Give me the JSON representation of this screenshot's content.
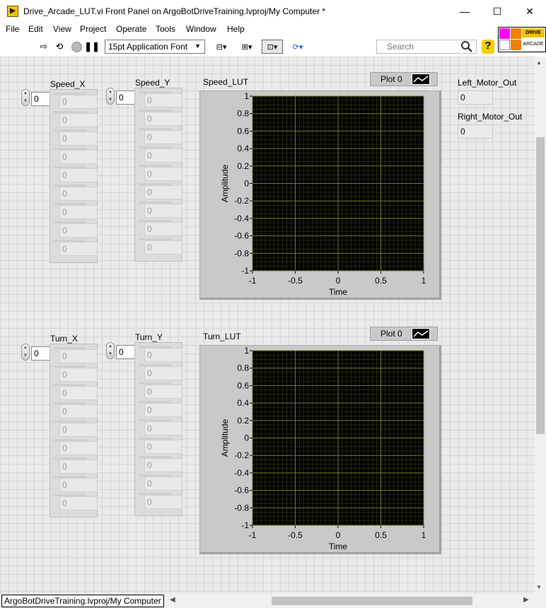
{
  "window": {
    "title": "Drive_Arcade_LUT.vi Front Panel on ArgoBotDriveTraining.lvproj/My Computer *",
    "minimize": "—",
    "maximize": "☐",
    "close": "✕"
  },
  "menu": [
    "File",
    "Edit",
    "View",
    "Project",
    "Operate",
    "Tools",
    "Window",
    "Help"
  ],
  "toolbar": {
    "font": "15pt Application Font",
    "search_placeholder": "Search",
    "icons": [
      "run-arrow",
      "run-continuously",
      "abort-execution",
      "pause",
      "align-objects",
      "distribute-objects",
      "resize-objects",
      "reorder",
      "search",
      "context-help"
    ]
  },
  "vi_icon": {
    "line1": "DRIVE",
    "line2": "ARCADE",
    "colors": [
      "#ff00ff",
      "#f08000",
      "#ffffff",
      "#f08000"
    ]
  },
  "arrays": [
    {
      "label": "Speed_X",
      "index": "0",
      "cells": [
        "0",
        "0",
        "0",
        "0",
        "0",
        "0",
        "0",
        "0",
        "0"
      ]
    },
    {
      "label": "Speed_Y",
      "index": "0",
      "cells": [
        "0",
        "0",
        "0",
        "0",
        "0",
        "0",
        "0",
        "0",
        "0"
      ]
    },
    {
      "label": "Turn_X",
      "index": "0",
      "cells": [
        "0",
        "0",
        "0",
        "0",
        "0",
        "0",
        "0",
        "0",
        "0"
      ]
    },
    {
      "label": "Turn_Y",
      "index": "0",
      "cells": [
        "0",
        "0",
        "0",
        "0",
        "0",
        "0",
        "0",
        "0",
        "0"
      ]
    }
  ],
  "indicators": [
    {
      "label": "Left_Motor_Out",
      "value": "0"
    },
    {
      "label": "Right_Motor_Out",
      "value": "0"
    }
  ],
  "graphs": [
    {
      "label": "Speed_LUT",
      "plot_legend": "Plot 0"
    },
    {
      "label": "Turn_LUT",
      "plot_legend": "Plot 0"
    }
  ],
  "chart_data": [
    {
      "type": "line",
      "title": "Speed_LUT",
      "xlabel": "Time",
      "ylabel": "Amplitude",
      "xlim": [
        -1,
        1
      ],
      "ylim": [
        -1,
        1
      ],
      "x_ticks": [
        "-1",
        "-0.5",
        "0",
        "0.5",
        "1"
      ],
      "y_ticks": [
        "1",
        "0.8",
        "0.6",
        "0.4",
        "0.2",
        "0",
        "-0.2",
        "-0.4",
        "-0.6",
        "-0.8",
        "-1"
      ],
      "grid": true,
      "plot_background": "#000000",
      "grid_color": "#6f7a22",
      "series": [
        {
          "name": "Plot 0",
          "values": []
        }
      ]
    },
    {
      "type": "line",
      "title": "Turn_LUT",
      "xlabel": "Time",
      "ylabel": "Amplitude",
      "xlim": [
        -1,
        1
      ],
      "ylim": [
        -1,
        1
      ],
      "x_ticks": [
        "-1",
        "-0.5",
        "0",
        "0.5",
        "1"
      ],
      "y_ticks": [
        "1",
        "0.8",
        "0.6",
        "0.4",
        "0.2",
        "0",
        "-0.2",
        "-0.4",
        "-0.6",
        "-0.8",
        "-1"
      ],
      "grid": true,
      "plot_background": "#000000",
      "grid_color": "#6f7a22",
      "series": [
        {
          "name": "Plot 0",
          "values": []
        }
      ]
    }
  ],
  "status": {
    "context": "ArgoBotDriveTraining.lvproj/My Computer"
  }
}
